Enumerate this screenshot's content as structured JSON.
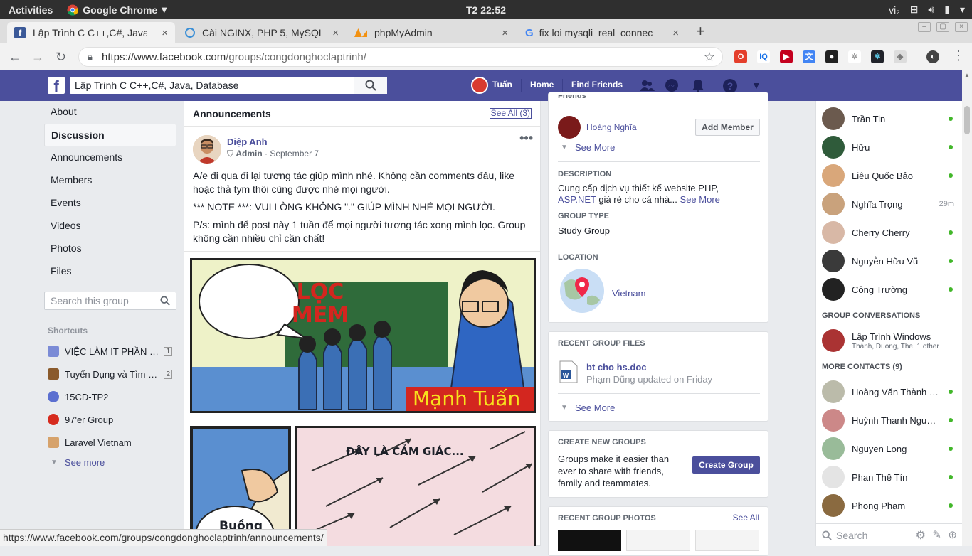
{
  "os": {
    "activities": "Activities",
    "app_name": "Google Chrome",
    "clock": "T2 22:52",
    "lang": "vi₂"
  },
  "tabs": [
    {
      "label": "Lập Trình C C++,C#, Java,",
      "close": "×"
    },
    {
      "label": "Cài NGINX, PHP 5, MySQL",
      "close": "×"
    },
    {
      "label": "phpMyAdmin",
      "close": "×"
    },
    {
      "label": "fix loi mysqli_real_connec",
      "close": "×"
    }
  ],
  "new_tab": "+",
  "url": {
    "prefix": "https://www.facebook.com",
    "path": "/groups/congdonghoclaptrinh/"
  },
  "fb": {
    "search_value": "Lập Trình C C++,C#, Java, Database",
    "user": "Tuấn",
    "home": "Home",
    "find_friends": "Find Friends"
  },
  "left_nav": [
    "About",
    "Discussion",
    "Announcements",
    "Members",
    "Events",
    "Videos",
    "Photos",
    "Files"
  ],
  "group_search_placeholder": "Search this group",
  "shortcuts": {
    "title": "Shortcuts",
    "items": [
      {
        "label": "VIỆC LÀM IT PHẦN MỀM",
        "count": "1",
        "color": "#7b8bd6"
      },
      {
        "label": "Tuyển Dụng và Tìm Việc",
        "count": "2",
        "color": "#8a5a2c"
      },
      {
        "label": "15CĐ-TP2",
        "count": "",
        "color": "#5b6fd0"
      },
      {
        "label": "97'er Group",
        "count": "",
        "color": "#d62b1e"
      },
      {
        "label": "Laravel Vietnam",
        "count": "",
        "color": "#d6a26b"
      }
    ],
    "see_more": "See more"
  },
  "announcements": {
    "title": "Announcements",
    "see_all": "See All (3)",
    "post": {
      "author": "Diệp Anh",
      "role": "Admin",
      "date": "September 7",
      "lines": [
        "A/e đi qua đi lại tương tác giúp mình nhé. Không cần comments đâu, like hoặc thả tym thôi cũng được nhé mọi người.",
        "*** NOTE ***: VUI LÒNG KHÔNG \".\" GIÚP MÌNH NHÉ MỌI NGƯỜI.",
        "P/s: mình để post này 1 tuần để mọi người tương tác xong mình lọc. Group không cần nhiều chỉ cần chất!"
      ],
      "comic": {
        "bubble1": "LỌC MEM",
        "name": "Mạnh Tuấn",
        "bubble2": "ĐÂY LÀ CẢM GIÁC...",
        "bubble3": "Buồng"
      }
    }
  },
  "info": {
    "friends_label": "Friends",
    "friend_name": "Hoàng Nghĩa",
    "add_member": "Add Member",
    "see_more": "See More",
    "description_title": "DESCRIPTION",
    "description_a": "Cung cấp dịch vụ thiết kế website PHP,",
    "description_link": "ASP.NET",
    "description_b": " giá rẻ cho cá nhà...",
    "description_more": "See More",
    "group_type_title": "GROUP TYPE",
    "group_type": "Study Group",
    "location_title": "LOCATION",
    "location": "Vietnam"
  },
  "files": {
    "title": "RECENT GROUP FILES",
    "file_name": "bt cho hs.doc",
    "file_meta": "Phạm Dũng updated on Friday",
    "see_more": "See More"
  },
  "create": {
    "title": "CREATE NEW GROUPS",
    "text": "Groups make it easier than ever to share with friends, family and teammates.",
    "button": "Create Group"
  },
  "photos": {
    "title": "RECENT GROUP PHOTOS",
    "see_all": "See All"
  },
  "chat": {
    "contacts": [
      {
        "name": "Trần Tin",
        "status": "online",
        "color": "#6b5a4e"
      },
      {
        "name": "Hữu",
        "status": "online",
        "color": "#2f5b3a"
      },
      {
        "name": "Liêu Quốc Bảo",
        "status": "online",
        "color": "#d9a77a"
      },
      {
        "name": "Nghĩa Trọng",
        "status": "29m",
        "color": "#c9a27c"
      },
      {
        "name": "Cherry Cherry",
        "status": "online",
        "color": "#d8b8a6"
      },
      {
        "name": "Nguyễn Hữu Vũ",
        "status": "online",
        "color": "#3a3a3a"
      },
      {
        "name": "Công Trường",
        "status": "online",
        "color": "#222"
      }
    ],
    "group_conv_title": "GROUP CONVERSATIONS",
    "group_conv": {
      "name": "Lập Trình Windows",
      "members": "Thành, Duong, The, 1 other",
      "color": "#a33"
    },
    "more_title": "MORE CONTACTS (9)",
    "more": [
      {
        "name": "Hoàng Văn Thành Công",
        "status": "online",
        "color": "#bba"
      },
      {
        "name": "Huỳnh Thanh Nguyên",
        "status": "online",
        "color": "#c88"
      },
      {
        "name": "Nguyen Long",
        "status": "online",
        "color": "#9b9"
      },
      {
        "name": "Phan Thế Tín",
        "status": "online",
        "color": "#e4e4e4"
      },
      {
        "name": "Phong Phạm",
        "status": "online",
        "color": "#8a6a40"
      }
    ],
    "search_placeholder": "Search"
  },
  "status_url": "https://www.facebook.com/groups/congdonghoclaptrinh/announcements/"
}
